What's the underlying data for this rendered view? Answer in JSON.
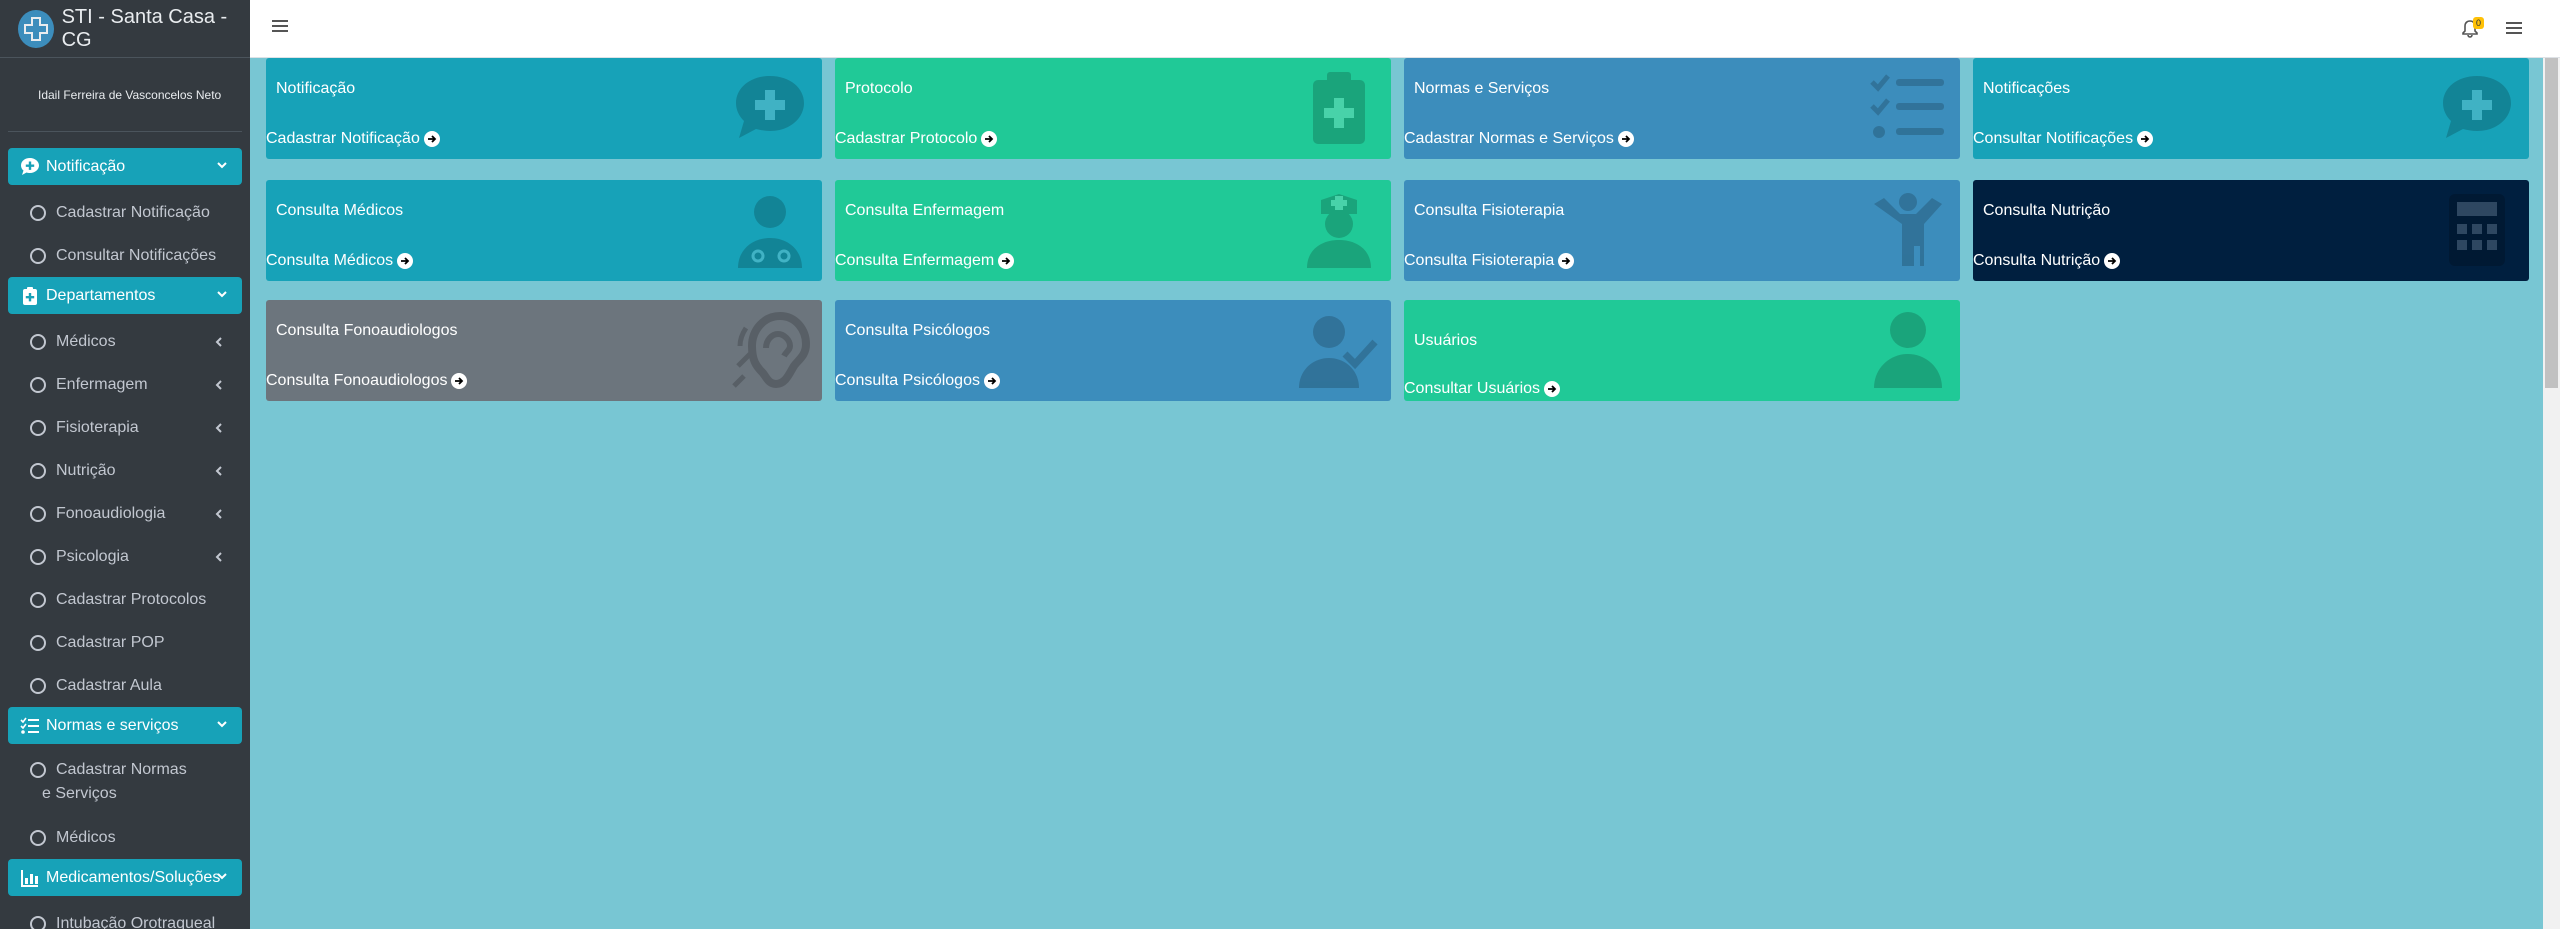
{
  "sidebar": {
    "brand": "STI - Santa Casa - CG",
    "user": "Idail Ferreira de Vasconcelos Neto",
    "menu": [
      {
        "type": "header",
        "label": "Notificação"
      },
      {
        "type": "item",
        "label": "Cadastrar Notificação"
      },
      {
        "type": "item",
        "label": "Consultar Notificações"
      },
      {
        "type": "header",
        "label": "Departamentos"
      },
      {
        "type": "item",
        "label": "Médicos",
        "expandable": true
      },
      {
        "type": "item",
        "label": "Enfermagem",
        "expandable": true
      },
      {
        "type": "item",
        "label": "Fisioterapia",
        "expandable": true
      },
      {
        "type": "item",
        "label": "Nutrição",
        "expandable": true
      },
      {
        "type": "item",
        "label": "Fonoaudiologia",
        "expandable": true
      },
      {
        "type": "item",
        "label": "Psicologia",
        "expandable": true
      },
      {
        "type": "item",
        "label": "Cadastrar Protocolos"
      },
      {
        "type": "item",
        "label": "Cadastrar POP"
      },
      {
        "type": "item",
        "label": "Cadastrar Aula"
      },
      {
        "type": "header",
        "label": "Normas e serviços"
      },
      {
        "type": "item",
        "label": "Cadastrar Normas e Serviços",
        "tall": true
      },
      {
        "type": "item",
        "label": "Médicos"
      },
      {
        "type": "header",
        "label": "Medicamentos/Soluções"
      },
      {
        "type": "item",
        "label": "Intubação Orotraqueal"
      }
    ]
  },
  "topbar": {
    "notification_count": "0"
  },
  "cards": [
    {
      "title": "Notificação",
      "link": "Cadastrar Notificação",
      "color": "#17a2b8",
      "icon": "comment-medical-icon"
    },
    {
      "title": "Protocolo",
      "link": "Cadastrar Protocolo",
      "color": "#20c997",
      "icon": "clipboard-medical-icon"
    },
    {
      "title": "Normas e Serviços",
      "link": "Cadastrar Normas e Serviços",
      "color": "#3c8dbc",
      "icon": "list-check-icon"
    },
    {
      "title": "Notificações",
      "link": "Consultar Notificações",
      "color": "#17a2b8",
      "icon": "comment-medical-icon"
    },
    {
      "title": "Consulta Médicos",
      "link": "Consulta Médicos",
      "color": "#17a2b8",
      "icon": "user-doctor-icon"
    },
    {
      "title": "Consulta Enfermagem",
      "link": "Consulta Enfermagem",
      "color": "#20c997",
      "icon": "user-nurse-icon"
    },
    {
      "title": "Consulta Fisioterapia",
      "link": "Consulta Fisioterapia",
      "color": "#3c8dbc",
      "icon": "child-icon"
    },
    {
      "title": "Consulta Nutrição",
      "link": "Consulta Nutrição",
      "color": "#001f3f",
      "icon": "calculator-icon"
    },
    {
      "title": "Consulta Fonoaudiologos",
      "link": "Consulta Fonoaudiologos",
      "color": "#6c757d",
      "icon": "ear-icon"
    },
    {
      "title": "Consulta Psicólogos",
      "link": "Consulta Psicólogos",
      "color": "#3c8dbc",
      "icon": "user-check-icon"
    },
    {
      "title": "Usuários",
      "link": "Consultar Usuários",
      "color": "#20c997",
      "icon": "user-icon"
    }
  ]
}
